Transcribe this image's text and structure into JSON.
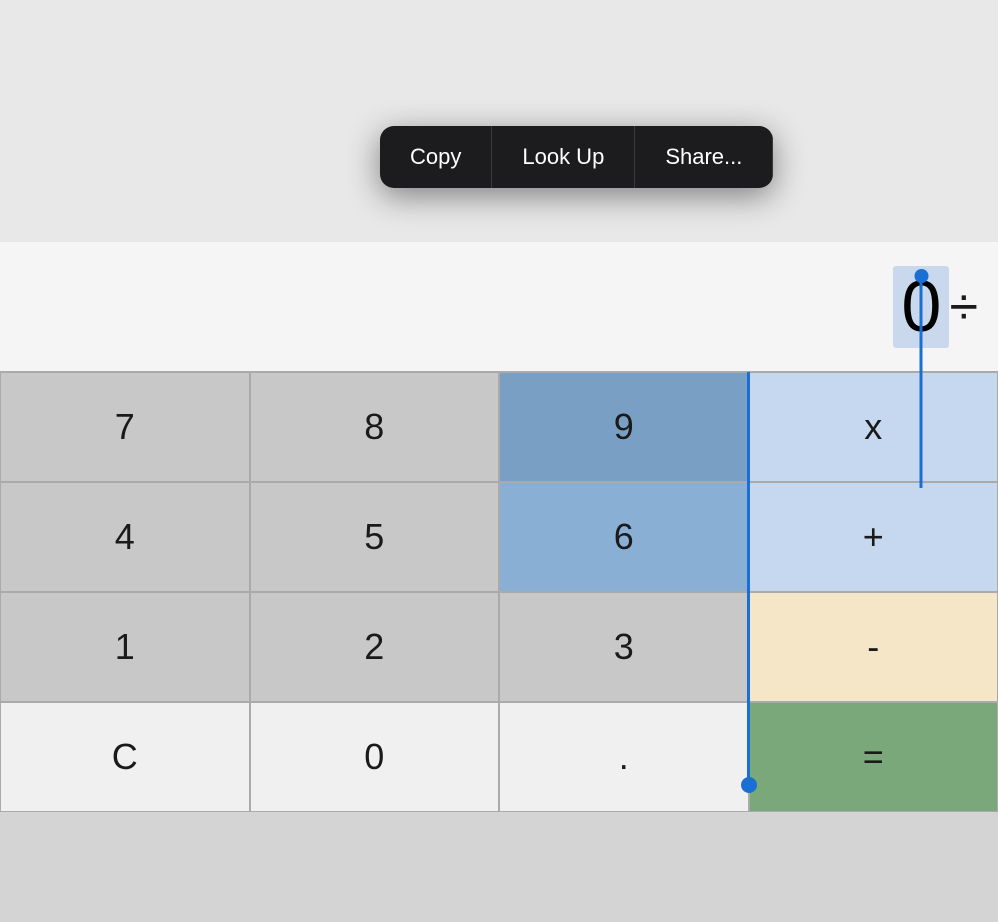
{
  "contextMenu": {
    "items": [
      "Copy",
      "Look Up",
      "Share..."
    ]
  },
  "display": {
    "value": "0"
  },
  "buttons": {
    "row1": [
      {
        "label": "7",
        "type": "num"
      },
      {
        "label": "8",
        "type": "num"
      },
      {
        "label": "9",
        "type": "num-selected-dark"
      },
      {
        "label": "x",
        "type": "op-selected"
      }
    ],
    "row2": [
      {
        "label": "4",
        "type": "num"
      },
      {
        "label": "5",
        "type": "num"
      },
      {
        "label": "6",
        "type": "num-selected"
      },
      {
        "label": "+",
        "type": "op-selected"
      }
    ],
    "row3": [
      {
        "label": "1",
        "type": "num"
      },
      {
        "label": "2",
        "type": "num"
      },
      {
        "label": "3",
        "type": "num"
      },
      {
        "label": "-",
        "type": "op"
      }
    ],
    "row4": [
      {
        "label": "C",
        "type": "num-light"
      },
      {
        "label": "0",
        "type": "num-light"
      },
      {
        "label": ".",
        "type": "num-light"
      },
      {
        "label": "=",
        "type": "eq"
      }
    ]
  }
}
